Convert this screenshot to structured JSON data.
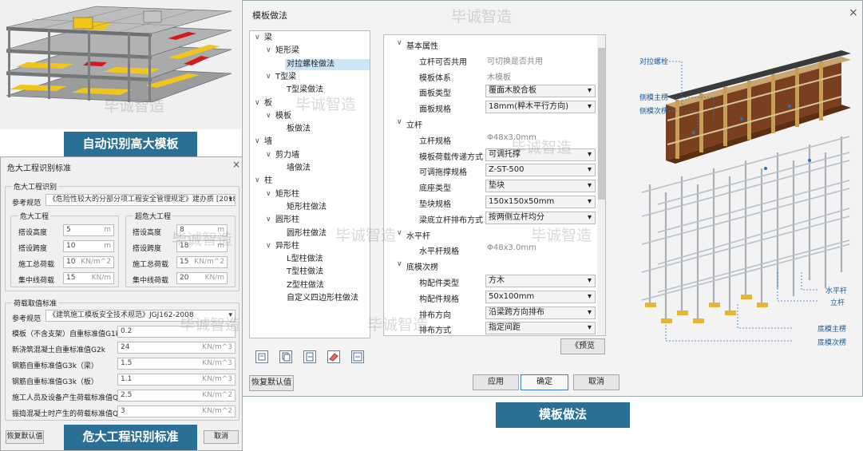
{
  "captions": {
    "auto_detect": "自动识别高大模板",
    "hazard": "危大工程识别标准",
    "formwork": "模板做法"
  },
  "watermark": "毕诚智造",
  "hazard_dialog": {
    "title": "危大工程识别标准",
    "close": "×",
    "group1_title": "危大工程识别",
    "ref_label": "参考规范",
    "ref_value": "《危险性较大的分部分项工程安全管理规定》建办质 [2018] 31号",
    "left_group": "危大工程",
    "right_group": "超危大工程",
    "left_fields": [
      {
        "label": "搭设高度",
        "value": "5",
        "unit": "m"
      },
      {
        "label": "搭设跨度",
        "value": "10",
        "unit": "m"
      },
      {
        "label": "施工总荷载",
        "value": "10",
        "unit": "KN/m^2"
      },
      {
        "label": "集中线荷载",
        "value": "15",
        "unit": "KN/m"
      }
    ],
    "right_fields": [
      {
        "label": "搭设高度",
        "value": "8",
        "unit": "m"
      },
      {
        "label": "搭设跨度",
        "value": "18",
        "unit": "m"
      },
      {
        "label": "施工总荷载",
        "value": "15",
        "unit": "KN/m^2"
      },
      {
        "label": "集中线荷载",
        "value": "20",
        "unit": "KN/m"
      }
    ],
    "group2_title": "荷载取值标准",
    "ref2_label": "参考规范",
    "ref2_value": "《建筑施工模板安全技术规范》JGJ162-2008",
    "loads": [
      {
        "label": "模板（不含支架）自重标准值G1k",
        "value": "0.2",
        "unit": ""
      },
      {
        "label": "新浇筑混凝土自重标准值G2k",
        "value": "24",
        "unit": "KN/m^3"
      },
      {
        "label": "钢筋自重标准值G3k（梁）",
        "value": "1.5",
        "unit": "KN/m^3"
      },
      {
        "label": "钢筋自重标准值G3k（板）",
        "value": "1.1",
        "unit": "KN/m^3"
      },
      {
        "label": "施工人员及设备产生荷载标准值Q1k",
        "value": "2.5",
        "unit": "KN/m^2"
      },
      {
        "label": "振捣混凝土时产生的荷载标准值Q2k",
        "value": "3",
        "unit": "KN/m^2"
      }
    ],
    "restore": "恢复默认值",
    "cancel": "取消"
  },
  "formwork_dialog": {
    "title": "模板做法",
    "close": "×",
    "tree": [
      {
        "label": "梁",
        "level": 0,
        "toggle": "∨"
      },
      {
        "label": "矩形梁",
        "level": 1,
        "toggle": "∨"
      },
      {
        "label": "对拉螺栓做法",
        "level": 2,
        "selected": true
      },
      {
        "label": "T型梁",
        "level": 1,
        "toggle": "∨"
      },
      {
        "label": "T型梁做法",
        "level": 2
      },
      {
        "label": "板",
        "level": 0,
        "toggle": "∨"
      },
      {
        "label": "模板",
        "level": 1,
        "toggle": "∨"
      },
      {
        "label": "板做法",
        "level": 2
      },
      {
        "label": "墙",
        "level": 0,
        "toggle": "∨"
      },
      {
        "label": "剪力墙",
        "level": 1,
        "toggle": "∨"
      },
      {
        "label": "墙做法",
        "level": 2
      },
      {
        "label": "柱",
        "level": 0,
        "toggle": "∨"
      },
      {
        "label": "矩形柱",
        "level": 1,
        "toggle": "∨"
      },
      {
        "label": "矩形柱做法",
        "level": 2
      },
      {
        "label": "圆形柱",
        "level": 1,
        "toggle": "∨"
      },
      {
        "label": "圆形柱做法",
        "level": 2
      },
      {
        "label": "异形柱",
        "level": 1,
        "toggle": "∨"
      },
      {
        "label": "L型柱做法",
        "level": 2
      },
      {
        "label": "T型柱做法",
        "level": 2
      },
      {
        "label": "Z型柱做法",
        "level": 2
      },
      {
        "label": "自定义四边形柱做法",
        "level": 2
      }
    ],
    "props": [
      {
        "type": "header",
        "label": "基本属性"
      },
      {
        "type": "row",
        "key": "立杆可否共用",
        "value": "可切换是否共用",
        "style": "gray"
      },
      {
        "type": "row",
        "key": "模板体系",
        "value": "木模板",
        "style": "gray"
      },
      {
        "type": "row",
        "key": "面板类型",
        "value": "覆面木胶合板",
        "style": "dd"
      },
      {
        "type": "row",
        "key": "面板规格",
        "value": "18mm(粹木平行方向)",
        "style": "dd"
      },
      {
        "type": "header",
        "label": "立杆"
      },
      {
        "type": "row",
        "key": "立杆规格",
        "value": "Φ48x3.0mm",
        "style": "gray"
      },
      {
        "type": "row",
        "key": "模板荷载传递方式",
        "value": "可调托撑",
        "style": "dd"
      },
      {
        "type": "row",
        "key": "可调拖撑规格",
        "value": "Z-ST-500",
        "style": "dd"
      },
      {
        "type": "row",
        "key": "底座类型",
        "value": "垫块",
        "style": "dd"
      },
      {
        "type": "row",
        "key": "垫块规格",
        "value": "150x150x50mm",
        "style": "dd"
      },
      {
        "type": "row",
        "key": "梁底立杆排布方式",
        "value": "按两侧立杆均分",
        "style": "dd"
      },
      {
        "type": "header",
        "label": "水平杆"
      },
      {
        "type": "row",
        "key": "水平杆规格",
        "value": "Φ48x3.0mm",
        "style": "gray"
      },
      {
        "type": "header",
        "label": "底模次楞"
      },
      {
        "type": "row",
        "key": "构配件类型",
        "value": "方木",
        "style": "dd"
      },
      {
        "type": "row",
        "key": "构配件规格",
        "value": "50x100mm",
        "style": "dd"
      },
      {
        "type": "row",
        "key": "排布方向",
        "value": "沿梁跨方向排布",
        "style": "dd"
      },
      {
        "type": "row",
        "key": "排布方式",
        "value": "指定间距",
        "style": "dd"
      },
      {
        "type": "header",
        "label": "底模主楞"
      }
    ],
    "preview": "《预览",
    "restore": "恢复默认值",
    "apply": "应用",
    "ok": "确定",
    "cancel": "取消",
    "diagram_labels": {
      "tie_bolt": "对拉螺栓",
      "side_main": "侧模主楞",
      "side_sec": "侧模次楞",
      "horiz_bar": "水平杆",
      "upright": "立杆",
      "bottom_main": "底模主楞",
      "bottom_sec": "底模次楞"
    }
  }
}
